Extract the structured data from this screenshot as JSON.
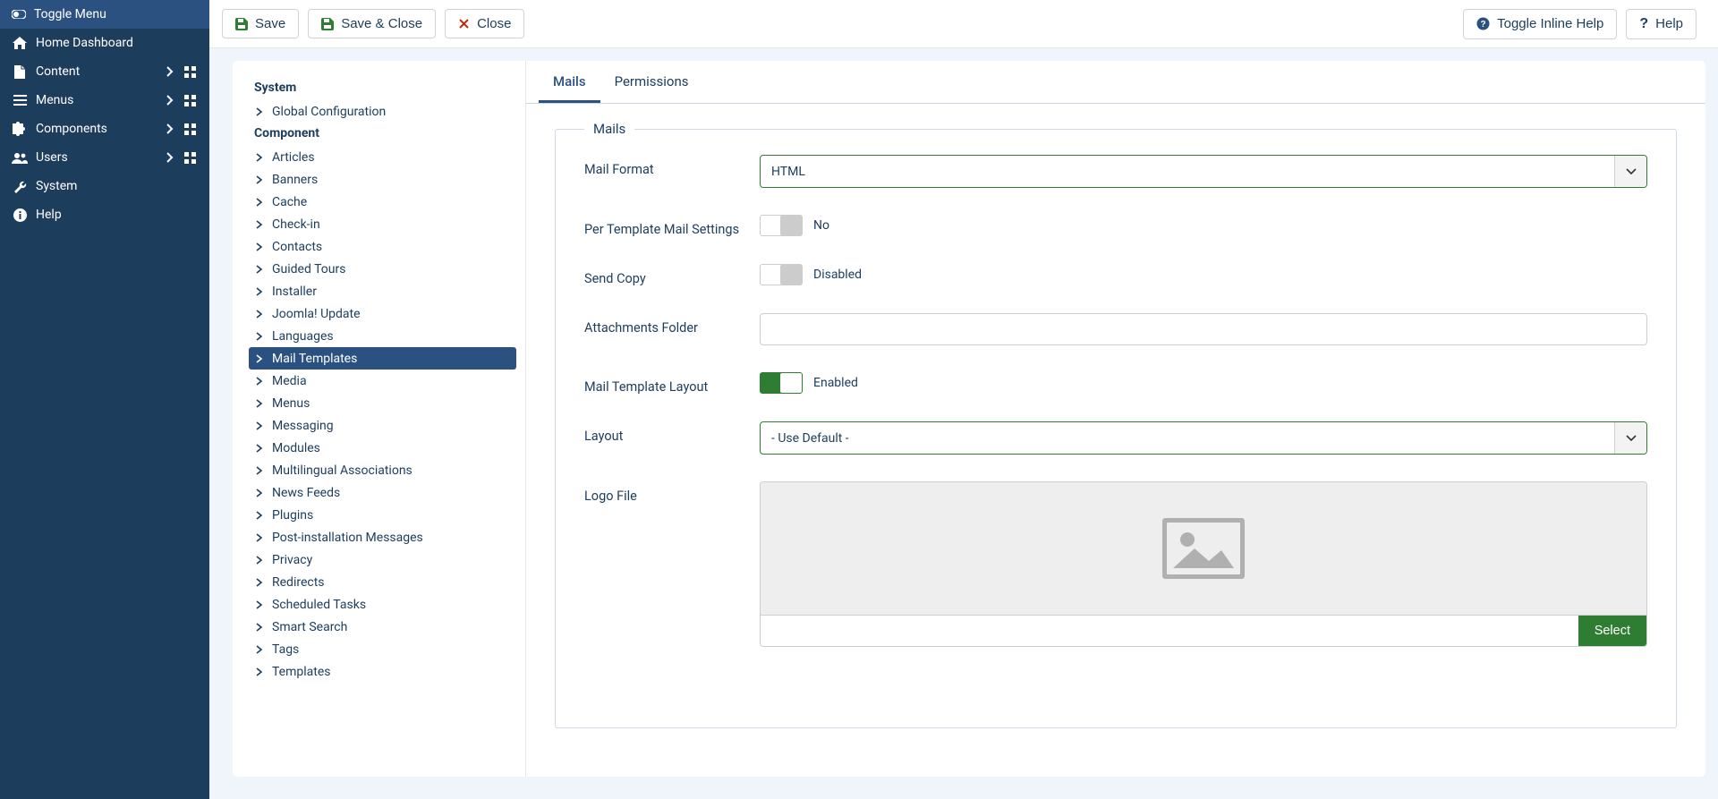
{
  "sidebar": {
    "toggle_label": "Toggle Menu",
    "items": [
      {
        "label": "Home Dashboard",
        "icon": "home",
        "expandable": false,
        "quick": false
      },
      {
        "label": "Content",
        "icon": "file",
        "expandable": true,
        "quick": true
      },
      {
        "label": "Menus",
        "icon": "list",
        "expandable": true,
        "quick": true
      },
      {
        "label": "Components",
        "icon": "puzzle",
        "expandable": true,
        "quick": true
      },
      {
        "label": "Users",
        "icon": "users",
        "expandable": true,
        "quick": true
      },
      {
        "label": "System",
        "icon": "wrench",
        "expandable": false,
        "quick": false
      },
      {
        "label": "Help",
        "icon": "info",
        "expandable": false,
        "quick": false
      }
    ]
  },
  "toolbar": {
    "save": "Save",
    "save_close": "Save & Close",
    "close": "Close",
    "toggle_help": "Toggle Inline Help",
    "help": "Help"
  },
  "config_sidebar": {
    "groups": [
      {
        "title": "System",
        "items": [
          "Global Configuration"
        ]
      },
      {
        "title": "Component",
        "items": [
          "Articles",
          "Banners",
          "Cache",
          "Check-in",
          "Contacts",
          "Guided Tours",
          "Installer",
          "Joomla! Update",
          "Languages",
          "Mail Templates",
          "Media",
          "Menus",
          "Messaging",
          "Modules",
          "Multilingual Associations",
          "News Feeds",
          "Plugins",
          "Post-installation Messages",
          "Privacy",
          "Redirects",
          "Scheduled Tasks",
          "Smart Search",
          "Tags",
          "Templates"
        ],
        "active_index": 9
      }
    ]
  },
  "tabs": {
    "mails": "Mails",
    "permissions": "Permissions"
  },
  "form": {
    "legend": "Mails",
    "mail_format": {
      "label": "Mail Format",
      "value": "HTML"
    },
    "per_template": {
      "label": "Per Template Mail Settings",
      "state": "No"
    },
    "send_copy": {
      "label": "Send Copy",
      "state": "Disabled"
    },
    "attachments_folder": {
      "label": "Attachments Folder",
      "value": ""
    },
    "mail_template_layout": {
      "label": "Mail Template Layout",
      "state": "Enabled"
    },
    "layout": {
      "label": "Layout",
      "value": "- Use Default -"
    },
    "logo_file": {
      "label": "Logo File",
      "select": "Select",
      "path": ""
    }
  }
}
